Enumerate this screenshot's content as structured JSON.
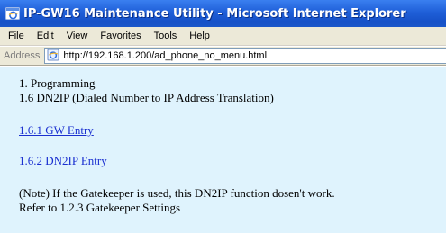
{
  "window": {
    "title": "IP-GW16 Maintenance Utility - Microsoft Internet Explorer",
    "app_icon": "internet-explorer-icon"
  },
  "menubar": {
    "items": [
      "File",
      "Edit",
      "View",
      "Favorites",
      "Tools",
      "Help"
    ]
  },
  "addressbar": {
    "label": "Address",
    "page_icon": "ie-page-icon",
    "url": "http://192.168.1.200/ad_phone_no_menu.html"
  },
  "content": {
    "heading_line1": "1. Programming",
    "heading_line2": "1.6 DN2IP (Dialed Number to IP Address Translation)",
    "links": [
      {
        "label": "1.6.1 GW Entry"
      },
      {
        "label": "1.6.2 DN2IP Entry"
      }
    ],
    "note_line1": "(Note) If the Gatekeeper is used, this DN2IP function dosen't work.",
    "note_line2": "Refer to 1.2.3 Gatekeeper Settings"
  },
  "colors": {
    "titlebar": "#1f5fd8",
    "chrome": "#ece9d8",
    "content_bg": "#dff3fd",
    "link": "#1a2fd0"
  }
}
